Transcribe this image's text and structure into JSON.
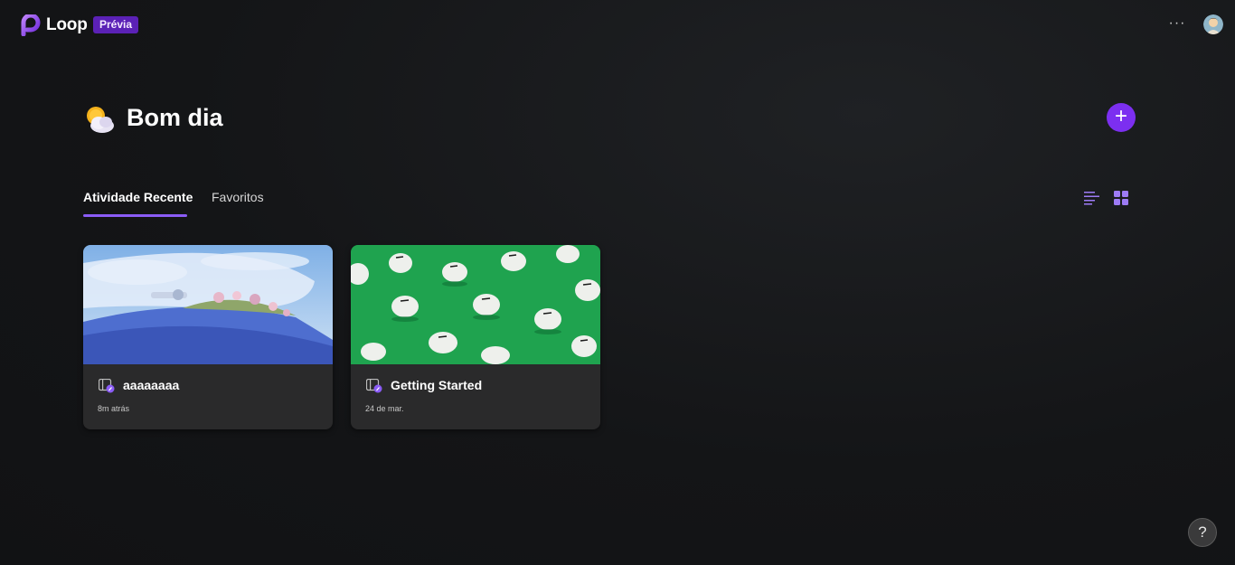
{
  "header": {
    "app_name": "Loop",
    "badge": "Prévia",
    "more_label": "···",
    "logo_icon": "loop-logo-icon",
    "avatar_icon": "user-avatar"
  },
  "main": {
    "greeting": "Bom dia",
    "greeting_icon": "sun-behind-cloud-icon",
    "new_button_label": "+",
    "tabs": [
      {
        "label": "Atividade Recente",
        "active": true
      },
      {
        "label": "Favoritos",
        "active": false
      }
    ],
    "view_toggle": {
      "list_icon": "list-view-icon",
      "grid_icon": "grid-view-icon",
      "selected": "grid"
    }
  },
  "cards": [
    {
      "title": "aaaaaaaa",
      "time": "8m atrás",
      "cover": "blue-landscape-cover",
      "icon": "loop-workspace-icon"
    },
    {
      "title": "Getting Started",
      "time": "24 de mar.",
      "cover": "piggy-banks-green-cover",
      "icon": "loop-workspace-icon"
    }
  ],
  "help": {
    "label": "?"
  },
  "colors": {
    "accent": "#7c2ff0",
    "tab_underline": "#8b5cf6",
    "badge_bg": "#5b21b6",
    "card_bg": "#2a2a2b"
  }
}
